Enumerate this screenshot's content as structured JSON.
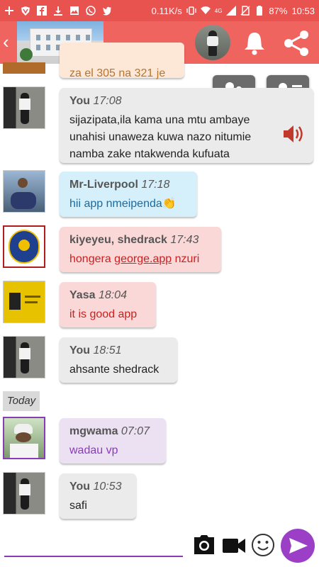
{
  "status_bar": {
    "network_speed": "0.11K/s",
    "network_type": "4G",
    "battery": "87%",
    "time": "10:53",
    "icons": [
      "plus-icon",
      "vpn-icon",
      "facebook-icon",
      "download-icon",
      "image-icon",
      "whatsapp-icon",
      "twitter-icon"
    ]
  },
  "header": {
    "back_icon": "chevron-left-icon",
    "bell_icon": "bell-icon",
    "share_icon": "share-icon"
  },
  "floating_buttons": [
    "group-members-icon",
    "contact-info-icon"
  ],
  "partial_message": "za el 305 na 321 je",
  "messages": [
    {
      "sender": "You",
      "time": "17:08",
      "text": "sijazipata,ila kama una mtu ambaye unahisi unaweza kuwa nazo nitumie namba zake ntakwenda kufuata",
      "style": "gray",
      "has_audio": true
    },
    {
      "sender": "Mr-Liverpool",
      "time": "17:18",
      "text": "hii app nmeipenda👏",
      "style": "blue"
    },
    {
      "sender": "kiyeyeu, shedrack",
      "time": "17:43",
      "text_prefix": "hongera ",
      "link": "george.app",
      "text_suffix": " nzuri",
      "style": "pink"
    },
    {
      "sender": "Yasa",
      "time": "18:04",
      "text": "it is good app",
      "style": "pink"
    },
    {
      "sender": "You",
      "time": "18:51",
      "text": "ahsante shedrack",
      "style": "gray"
    },
    {
      "sender": "mgwama",
      "time": "07:07",
      "text": "wadau vp",
      "style": "purple"
    },
    {
      "sender": "You",
      "time": "10:53",
      "text": "safi",
      "style": "gray"
    }
  ],
  "divider": "Today",
  "input": {
    "placeholder": "",
    "value": ""
  },
  "toolbar_icons": [
    "camera-icon",
    "video-icon",
    "emoji-icon",
    "send-icon"
  ],
  "colors": {
    "status_bar": "#e8524f",
    "app_bar": "#f0645f",
    "accent": "#9b3fc6",
    "link": "#cc1f1f"
  }
}
